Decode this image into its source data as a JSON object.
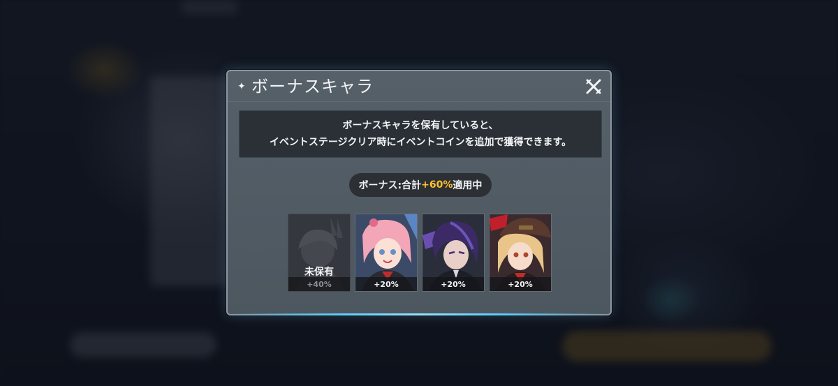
{
  "dialog": {
    "title": "ボーナスキャラ",
    "title_icon": "sparkle-icon",
    "close_icon": "close-icon",
    "info_lines": [
      "ボーナスキャラを保有していると、",
      "イベントステージクリア時にイベントコインを追加で獲得できます。"
    ],
    "bonus": {
      "prefix": "ボーナス:合計",
      "value": "+60%",
      "suffix": "適用中"
    },
    "characters": [
      {
        "status": "未保有",
        "bonus": "+40%",
        "owned": false
      },
      {
        "bonus": "+20%",
        "owned": true
      },
      {
        "bonus": "+20%",
        "owned": true
      },
      {
        "bonus": "+20%",
        "owned": true
      }
    ]
  },
  "colors": {
    "accent_yellow": "#ffc22a",
    "glow_cyan": "#5fd0ff",
    "panel": "#566069",
    "info_box": "#2b3036"
  }
}
